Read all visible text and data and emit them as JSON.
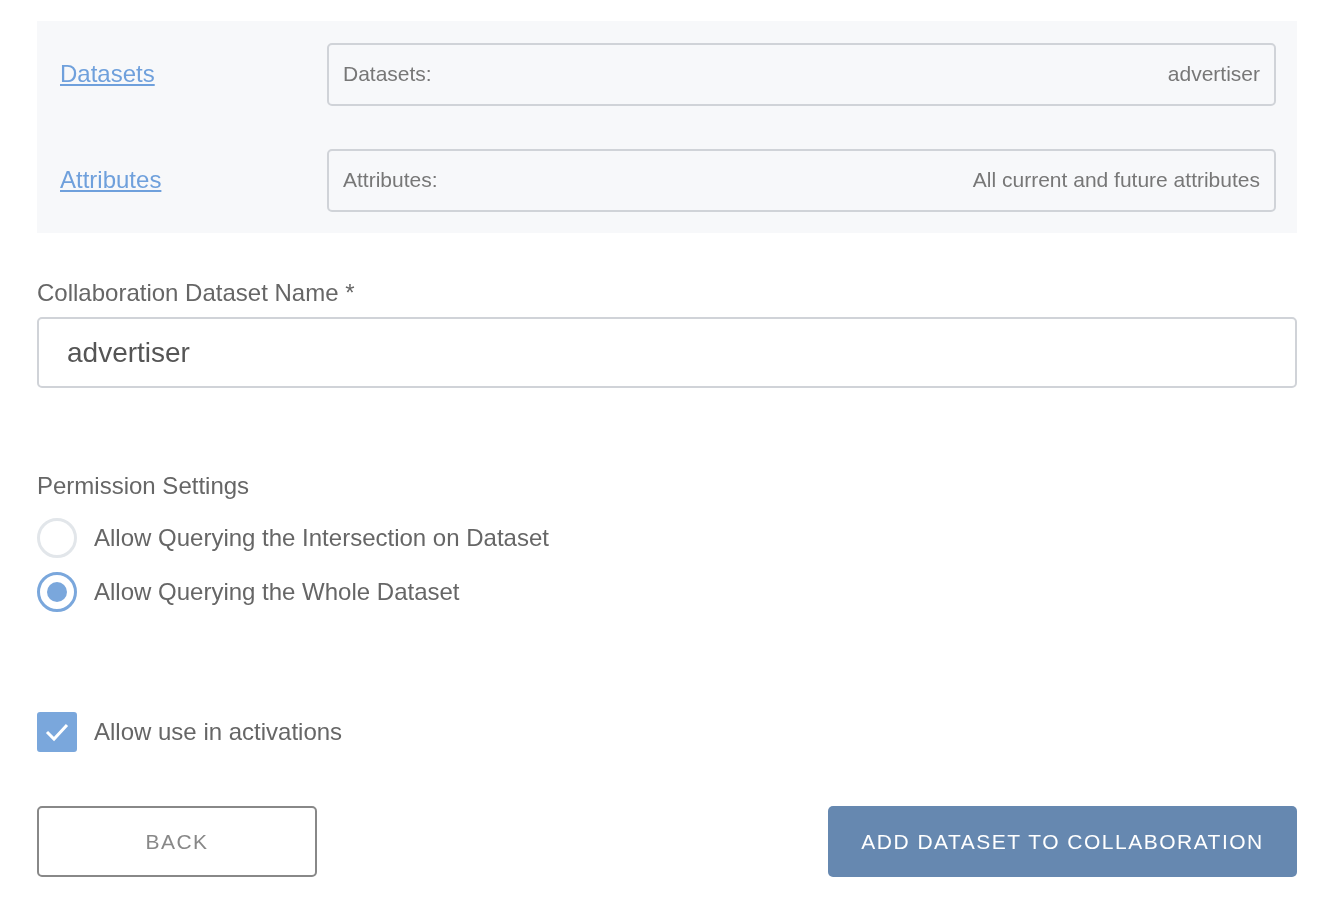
{
  "filters": [
    {
      "link": "Datasets",
      "field_label": "Datasets:",
      "field_value": "advertiser"
    },
    {
      "link": "Attributes",
      "field_label": "Attributes:",
      "field_value": "All current and future attributes"
    }
  ],
  "name_field": {
    "label": "Collaboration Dataset Name *",
    "value": "advertiser"
  },
  "permission": {
    "title": "Permission Settings",
    "options": [
      {
        "label": "Allow Querying the Intersection on Dataset",
        "selected": false
      },
      {
        "label": "Allow Querying the Whole Dataset",
        "selected": true
      }
    ]
  },
  "activation": {
    "label": "Allow use in activations",
    "checked": true
  },
  "buttons": [
    {
      "label": "BACK",
      "kind": "secondary"
    },
    {
      "label": "ADD DATASET TO COLLABORATION",
      "kind": "primary"
    }
  ]
}
